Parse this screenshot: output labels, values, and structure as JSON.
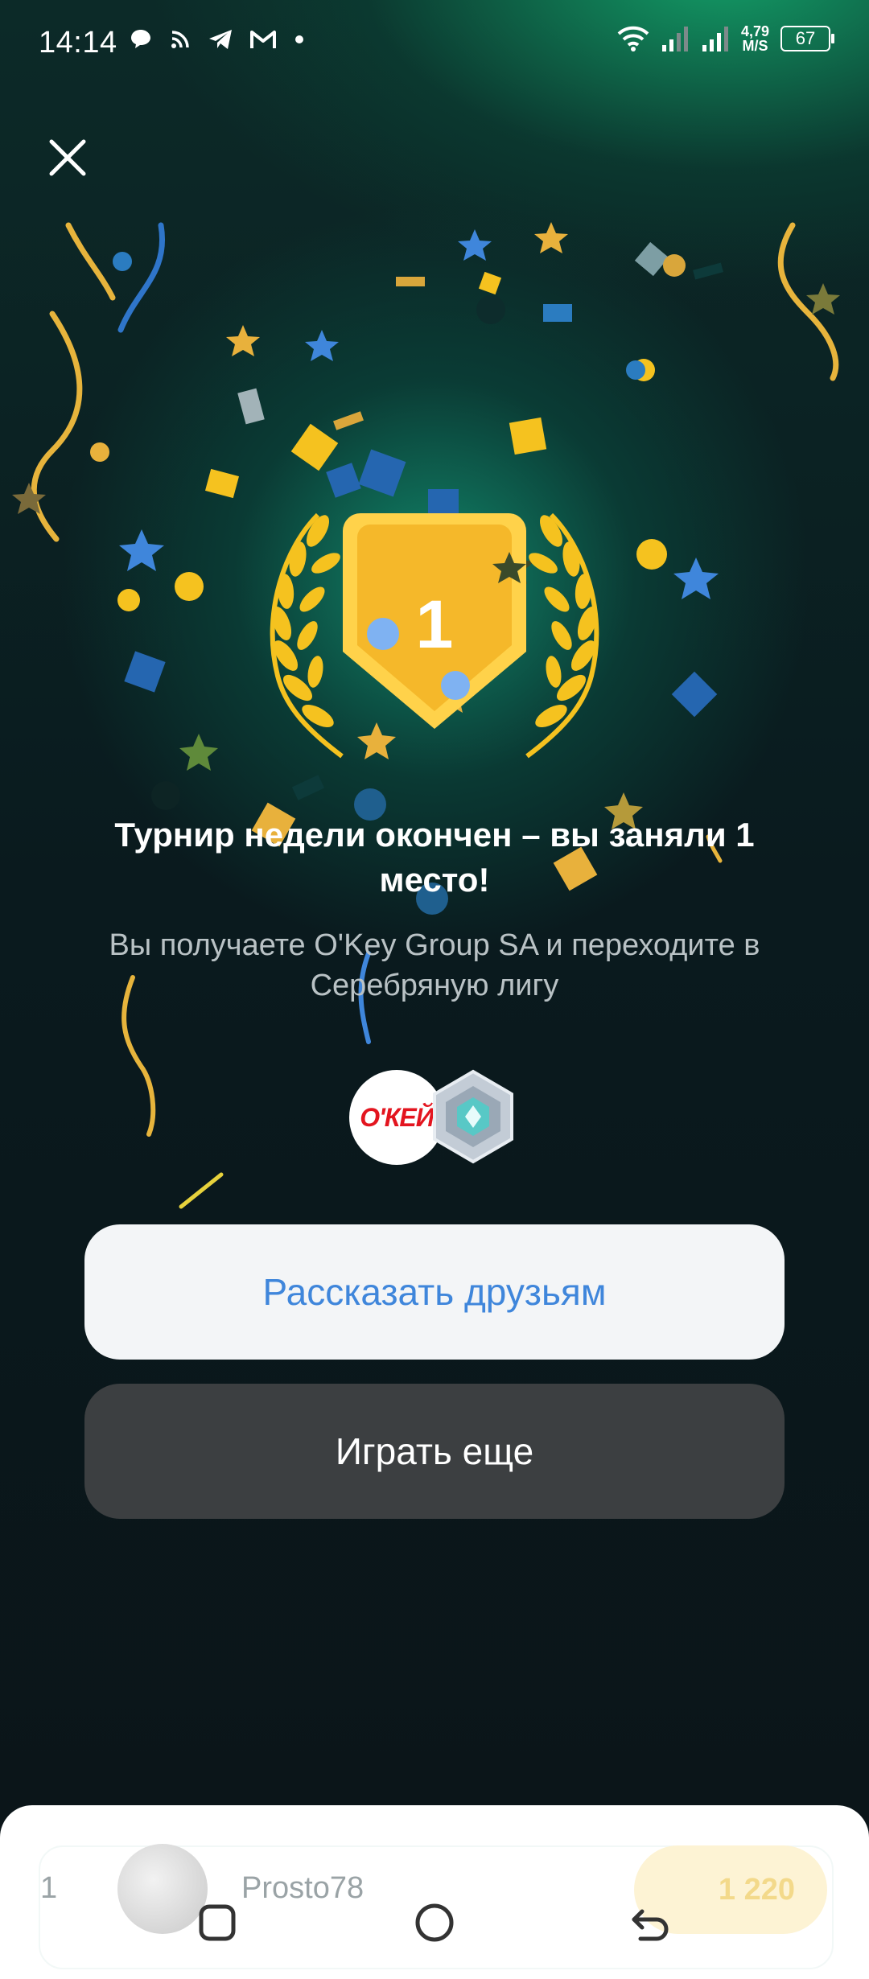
{
  "status_bar": {
    "time": "14:14",
    "speed_value": "4,79",
    "speed_unit": "M/S",
    "battery": "67"
  },
  "dialog": {
    "medal_rank": "1",
    "title": "Турнир недели окончен – вы заняли 1 место!",
    "subtitle": "Вы получаете O'Key Group SA и переходите в Серебряную лигу",
    "brand_logo_text": "О'КЕЙ"
  },
  "buttons": {
    "share_label": "Рассказать друзьям",
    "play_label": "Играть еще"
  },
  "leaderboard_row": {
    "rank": "1",
    "name": "Prosto78",
    "score": "1 220"
  },
  "colors": {
    "accent_blue": "#3f86db",
    "medal_gold": "#f5b82a",
    "okey_red": "#e3151f",
    "button_dark": "#3c3f41",
    "button_light": "#f3f5f7"
  },
  "icons": {
    "close": "close-icon",
    "nav_recents": "square-icon",
    "nav_home": "circle-icon",
    "nav_back": "back-arrow-icon"
  }
}
